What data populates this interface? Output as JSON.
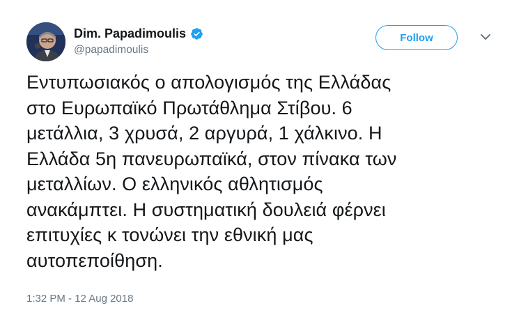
{
  "author": {
    "display_name": "Dim. Papadimoulis",
    "handle": "@papadimoulis",
    "verified_icon": "verified-badge-icon",
    "avatar_icon": "profile-photo"
  },
  "actions": {
    "follow_label": "Follow",
    "menu_icon": "chevron-down-icon"
  },
  "tweet": {
    "text": "Εντυπωσιακός ο απολογισμός της Ελλάδας\nστο Ευρωπαϊκό Πρωτάθλημα Στίβου. 6\nμετάλλια, 3 χρυσά, 2 αργυρά, 1 χάλκινο. Η\nΕλλάδα 5η πανευρωπαϊκά, στον πίνακα των\nμεταλλίων. Ο ελληνικός αθλητισμός\nανακάμπτει. Η συστηματική δουλειά φέρνει\nεπιτυχίες κ τονώνει την εθνική μας\nαυτοπεποίθηση.",
    "timestamp": "1:32 PM - 12 Aug 2018"
  },
  "colors": {
    "accent": "#1da1f2",
    "secondary_text": "#657786",
    "primary_text": "#14171a"
  }
}
